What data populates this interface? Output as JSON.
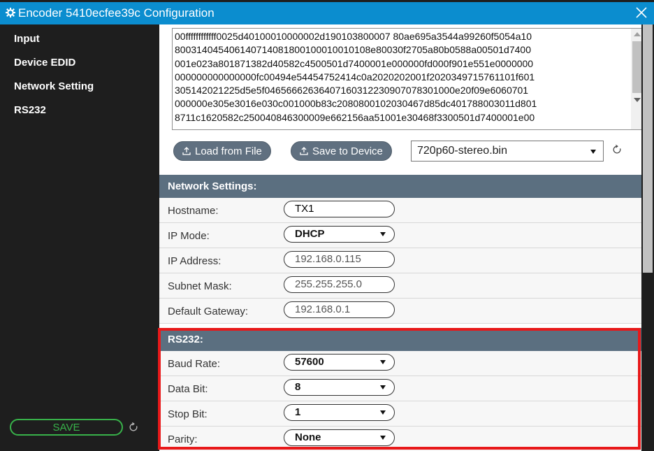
{
  "window": {
    "title": "Encoder 5410ecfee39c Configuration",
    "title_icon": "gear-icon",
    "close_icon": "close-icon"
  },
  "sidebar": {
    "items": [
      {
        "label": "Input"
      },
      {
        "label": "Device EDID"
      },
      {
        "label": "Network Setting"
      },
      {
        "label": "RS232"
      }
    ],
    "save_label": "SAVE",
    "refresh_icon": "refresh-icon"
  },
  "edid": {
    "lines": [
      "00ffffffffffff0025d40100010000002d190103800007 80ae695a3544a99260f5054a10",
      "800314045406140714081800100010010108e80030f2705a80b0588a00501d7400",
      "001e023a801871382d40582c4500501d7400001e000000fd000f901e551e0000000",
      "000000000000000fc00494e54454752414c0a2020202001f2020349715761101f601",
      "305142021225d5e5f04656662636407160312230907078301000e20f09e6060701",
      "000000e305e3016e030c001000b83c2080800102030467d85dc401788003011d801",
      "8711c1620582c250040846300009e662156aa51001e30468f3300501d7400001e00"
    ],
    "load_label": "Load from File",
    "save_label": "Save to Device",
    "file_selected": "720p60-stereo.bin"
  },
  "network": {
    "heading": "Network Settings:",
    "hostname_label": "Hostname:",
    "hostname_value": "TX1",
    "ipmode_label": "IP Mode:",
    "ipmode_value": "DHCP",
    "ip_label": "IP Address:",
    "ip_value": "192.168.0.115",
    "subnet_label": "Subnet Mask:",
    "subnet_value": "255.255.255.0",
    "gateway_label": "Default Gateway:",
    "gateway_value": "192.168.0.1"
  },
  "rs232": {
    "heading": "RS232:",
    "baud_label": "Baud Rate:",
    "baud_value": "57600",
    "databit_label": "Data Bit:",
    "databit_value": "8",
    "stopbit_label": "Stop Bit:",
    "stopbit_value": "1",
    "parity_label": "Parity:",
    "parity_value": "None"
  },
  "colors": {
    "titlebar": "#0b8dcf",
    "sidebar": "#1e1e1e",
    "section_header": "#5b6f80",
    "save_green": "#38b24a",
    "highlight_red": "#e8191a"
  }
}
